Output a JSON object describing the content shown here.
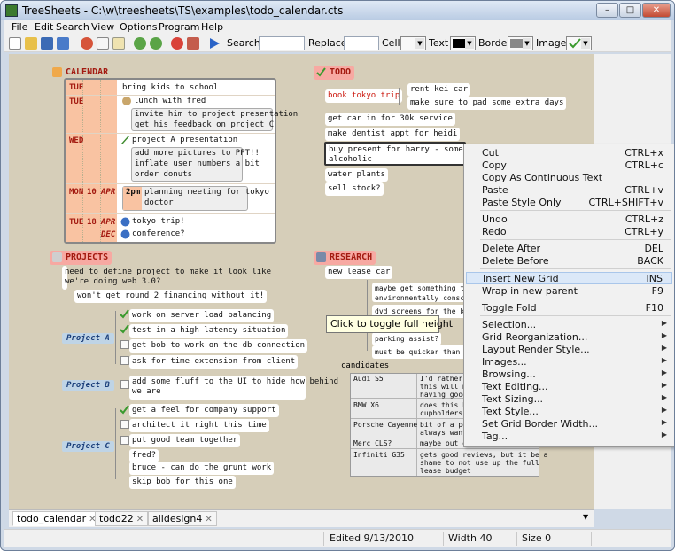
{
  "window": {
    "title": "TreeSheets - C:\\w\\treesheets\\TS\\examples\\todo_calendar.cts",
    "minimize": "–",
    "maximize": "□",
    "close": "✕"
  },
  "menubar": [
    "File",
    "Edit",
    "Search",
    "View",
    "Options",
    "Program",
    "Help"
  ],
  "toolbar": {
    "search_label": "Search",
    "replace_label": "Replace",
    "cell_label": "Cell",
    "text_label": "Text",
    "border_label": "Border",
    "image_label": "Image",
    "colors": {
      "text_swatch": "#000000",
      "border_swatch": "#888888"
    }
  },
  "calendar": {
    "title": "CALENDAR",
    "rows": [
      {
        "day": "TUE",
        "num": "",
        "month": "",
        "text": "bring kids to school"
      },
      {
        "day": "TUE",
        "num": "",
        "month": "",
        "text": "lunch with fred",
        "sub": [
          "invite him to project presentation",
          "get his feedback on project C"
        ]
      },
      {
        "day": "WED",
        "num": "",
        "month": "",
        "text": "project A presentation",
        "sub": [
          "add more pictures to PPT!!",
          "inflate user numbers a bit",
          "order donuts"
        ]
      },
      {
        "day": "MON",
        "num": "10",
        "month": "APR",
        "sub": [
          "2pm",
          "planning meeting for tokyo",
          "doctor"
        ]
      },
      {
        "day": "TUE",
        "num": "18",
        "month": "APR",
        "text": "tokyo trip!"
      },
      {
        "day": "",
        "num": "",
        "month": "DEC",
        "text": "conference?"
      }
    ]
  },
  "todo": {
    "title": "TODO",
    "items": [
      "book tokyo trip",
      "get car in for 30k service",
      "make dentist appt for heidi",
      "buy present for harry - something alcoholic",
      "water plants",
      "sell stock?"
    ],
    "book_sub": [
      "rent kei car",
      "make sure to pad some extra days"
    ],
    "present_line1": "buy present for harry - someth",
    "present_line2": "alcoholic"
  },
  "projects": {
    "title": "PROJECTS",
    "intro": [
      "need to define project to make it look like",
      "we're doing web 3.0?"
    ],
    "financing": "won't get round 2 financing without it!",
    "a": {
      "label": "Project A",
      "items": [
        "work on server load balancing",
        "test in a high latency situation",
        "get bob to work on the db connection",
        "ask for time extension from client"
      ]
    },
    "b": {
      "label": "Project B",
      "items": [
        "add some fluff to the UI to hide how behind",
        "we are"
      ]
    },
    "c": {
      "label": "Project C",
      "items": [
        "get a feel for company support",
        "architect it right this time",
        "put good team together"
      ],
      "sub": [
        "fred?",
        "bruce - can do the grunt work",
        "skip bob for this one"
      ]
    }
  },
  "research": {
    "title": "RESEARCH",
    "lease": "new lease car",
    "notes": [
      "maybe get something th",
      "environmentally consc",
      "dvd screens for the ki",
      "parking assist?",
      "must be quicker than f"
    ],
    "candidates_label": "candidates",
    "candidates": [
      {
        "name": "Audi S5",
        "note": [
          "I'd rather",
          "this will m",
          "having good"
        ]
      },
      {
        "name": "BMW X6",
        "note": [
          "does this h",
          "cupholders?"
        ]
      },
      {
        "name": "Porsche Cayenne",
        "note": [
          "bit of a po",
          "always want"
        ]
      },
      {
        "name": "Merc CLS?",
        "note": [
          "maybe out o"
        ]
      },
      {
        "name": "Infiniti G35",
        "note": [
          "gets good reviews, but it be a",
          "shame to not use up the full",
          "lease budget"
        ]
      }
    ]
  },
  "tooltip": "Click to toggle full height",
  "context_menu": [
    {
      "label": "Cut",
      "shortcut": "CTRL+x"
    },
    {
      "label": "Copy",
      "shortcut": "CTRL+c"
    },
    {
      "label": "Copy As Continuous Text",
      "shortcut": ""
    },
    {
      "label": "Paste",
      "shortcut": "CTRL+v"
    },
    {
      "label": "Paste Style Only",
      "shortcut": "CTRL+SHIFT+v"
    },
    {
      "label": "Undo",
      "shortcut": "CTRL+z"
    },
    {
      "label": "Redo",
      "shortcut": "CTRL+y"
    },
    {
      "label": "Delete After",
      "shortcut": "DEL"
    },
    {
      "label": "Delete Before",
      "shortcut": "BACK"
    },
    {
      "label": "Insert New Grid",
      "shortcut": "INS"
    },
    {
      "label": "Wrap in new parent",
      "shortcut": "F9"
    },
    {
      "label": "Toggle Fold",
      "shortcut": "F10"
    },
    {
      "label": "Selection...",
      "shortcut": ""
    },
    {
      "label": "Grid Reorganization...",
      "shortcut": ""
    },
    {
      "label": "Layout  Render Style...",
      "shortcut": ""
    },
    {
      "label": "Images...",
      "shortcut": ""
    },
    {
      "label": "Browsing...",
      "shortcut": ""
    },
    {
      "label": "Text Editing...",
      "shortcut": ""
    },
    {
      "label": "Text Sizing...",
      "shortcut": ""
    },
    {
      "label": "Text Style...",
      "shortcut": ""
    },
    {
      "label": "Set Grid Border Width...",
      "shortcut": ""
    },
    {
      "label": "Tag...",
      "shortcut": ""
    }
  ],
  "tabs": [
    "todo_calendar",
    "todo22",
    "alldesign4"
  ],
  "status": {
    "edited": "Edited 9/13/2010",
    "width": "Width 40",
    "size": "Size 0"
  }
}
